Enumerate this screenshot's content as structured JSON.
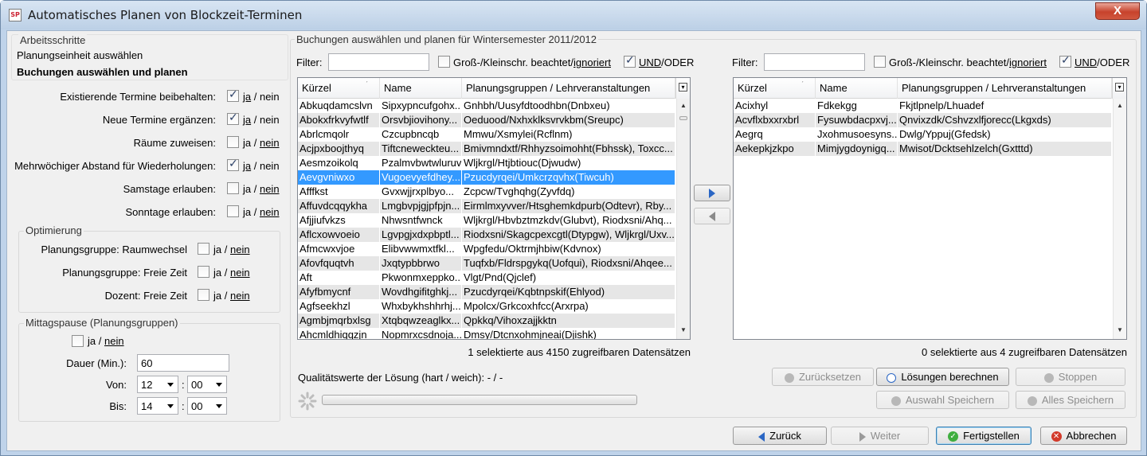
{
  "window": {
    "title": "Automatisches Planen von Blockzeit-Terminen",
    "app_icon": "SP",
    "close": "X"
  },
  "steps": {
    "title": "Arbeitsschritte",
    "step1": "Planungseinheit auswählen",
    "step2": "Buchungen auswählen und planen"
  },
  "options": [
    {
      "label": "Existierende Termine beibehalten:",
      "checked": true,
      "ja": "ja",
      "nein": "nein",
      "underline": "ja"
    },
    {
      "label": "Neue Termine ergänzen:",
      "checked": true,
      "ja": "ja",
      "nein": "nein",
      "underline": "ja"
    },
    {
      "label": "Räume zuweisen:",
      "checked": false,
      "ja": "ja",
      "nein": "nein",
      "underline": "nein"
    },
    {
      "label": "Mehrwöchiger Abstand für Wiederholungen:",
      "checked": true,
      "ja": "ja",
      "nein": "nein",
      "underline": "ja"
    },
    {
      "label": "Samstage erlauben:",
      "checked": false,
      "ja": "ja",
      "nein": "nein",
      "underline": "nein"
    },
    {
      "label": "Sonntage erlauben:",
      "checked": false,
      "ja": "ja",
      "nein": "nein",
      "underline": "nein"
    }
  ],
  "optimierung": {
    "title": "Optimierung",
    "items": [
      {
        "label": "Planungsgruppe: Raumwechsel",
        "ja": "ja",
        "nein": "nein"
      },
      {
        "label": "Planungsgruppe: Freie Zeit",
        "ja": "ja",
        "nein": "nein"
      },
      {
        "label": "Dozent: Freie Zeit",
        "ja": "ja",
        "nein": "nein"
      }
    ],
    "sep": "/"
  },
  "mittag": {
    "title": "Mittagspause (Planungsgruppen)",
    "ja": "ja",
    "nein": "nein",
    "sep": "/",
    "dauer_label": "Dauer (Min.):",
    "dauer_value": "60",
    "von_label": "Von:",
    "von_h": "12",
    "von_m": "00",
    "bis_label": "Bis:",
    "bis_h": "14",
    "bis_m": "00",
    "colon": ":"
  },
  "main": {
    "title": "Buchungen auswählen und planen für Wintersemester 2011/2012"
  },
  "filter": {
    "label": "Filter:",
    "case": "Groß-/Kleinschr. beachtet/",
    "ignore": "ignoriert",
    "und": "UND",
    "oder": "/ODER"
  },
  "columns": {
    "kuerzel": "Kürzel",
    "name": "Name",
    "gruppen": "Planungsgruppen / Lehrveranstaltungen"
  },
  "left_table": {
    "rows": [
      [
        "Abkuqdamcslvn",
        "Sipxypncufgohx...",
        "Gnhbh/Uusyfdtoodhbn(Dnbxeu)"
      ],
      [
        "Abokxfrkvyfwtlf",
        "Orsvbjiovihony...",
        "Oeduood/Nxhxklksvrvkbm(Sreupc)"
      ],
      [
        "Abrlcmqolr",
        "Czcupbncqb",
        "Mmwu/Xsmylei(Rcflnm)"
      ],
      [
        "Acjpxboojthyq",
        "Tiftcneweckteu...",
        "Bmivmndxtf/Rhhyzsoimohht(Fbhssk), Toxcc..."
      ],
      [
        "Aesmzoikolq",
        "Pzalmvbwtwluruv",
        "Wljkrgl/Htjbtiouc(Djwudw)"
      ],
      [
        "Aevgvniwxo",
        "Vugoevyefdhey...",
        "Pzucdyrqei/Umkcrzqvhx(Tiwcuh)"
      ],
      [
        "Afffkst",
        "Gvxwjjrxplbyo...",
        "Zcpcw/Tvghqhg(Zyvfdq)"
      ],
      [
        "Affuvdcqqykha",
        "Lmgbvpjgjpfpjn...",
        "Eirmlmxyvver/Htsghemkdpurb(Odtevr), Rby..."
      ],
      [
        "Afjjiufvkzs",
        "Nhwsntfwnck",
        "Wljkrgl/Hbvbztmzkdv(Glubvt), Riodxsni/Ahq..."
      ],
      [
        "Aflcxowvoeio",
        "Lgvpgjxdxpbptl...",
        "Riodxsni/Skagcpexcgtl(Dtypgw), Wljkrgl/Uxv..."
      ],
      [
        "Afmcwxvjoe",
        "Elibvwwmxtfkl...",
        "Wpgfedu/Oktrmjhbiw(Kdvnox)"
      ],
      [
        "Afovfquqtvh",
        "Jxqtypbbrwo",
        "Tuqfxb/Fldrspgykq(Uofqui), Riodxsni/Ahqee..."
      ],
      [
        "Aft",
        "Pkwonmxeppko...",
        "Vlgt/Pnd(Qjclef)"
      ],
      [
        "Afyfbmycnf",
        "Wovdhgifitghkj...",
        "Pzucdyrqei/Kqbtnpskif(Ehlyod)"
      ],
      [
        "Agfseekhzl",
        "Whxbykhshhrhj...",
        "Mpolcx/Grkcoxhfcc(Arxrpa)"
      ],
      [
        "Agmbjmqrbxlsg",
        "Xtqbqwzeaglkx...",
        "Qpkkq/Vihoxzajjkktn"
      ],
      [
        "Ahcmldhiqqzjn",
        "Nopmrxcsdnoja...",
        "Dmsy/Dtcnxohmjneai(Djishk)"
      ]
    ],
    "selected_index": 5,
    "status": "1 selektierte aus 4150 zugreifbaren Datensätzen"
  },
  "right_table": {
    "rows": [
      [
        "Acixhyl",
        "Fdkekgg",
        "Fkjtlpnelp/Lhuadef"
      ],
      [
        "Acvflxbxxrxbrl",
        "Fysuwbdacpxvj...",
        "Qnvixzdk/Cshvzxlfjorecc(Lkgxds)"
      ],
      [
        "Aegrq",
        "Jxohmusoesyns...",
        "Dwlg/Yppuj(Gfedsk)"
      ],
      [
        "Aekepkjzkpo",
        "Mimjygdoynigq...",
        "Mwisot/Dcktsehlzelch(Gxtttd)"
      ]
    ],
    "status": "0 selektierte aus 4 zugreifbaren Datensätzen"
  },
  "quality": {
    "label": "Qualitätswerte der Lösung (hart / weich): - / -",
    "progress": 0
  },
  "actions": {
    "reset": "Zurücksetzen",
    "compute": "Lösungen berechnen",
    "stop": "Stoppen",
    "save_sel": "Auswahl Speichern",
    "save_all": "Alles Speichern"
  },
  "footer": {
    "back": "Zurück",
    "next": "Weiter",
    "finish": "Fertigstellen",
    "cancel": "Abbrechen"
  }
}
